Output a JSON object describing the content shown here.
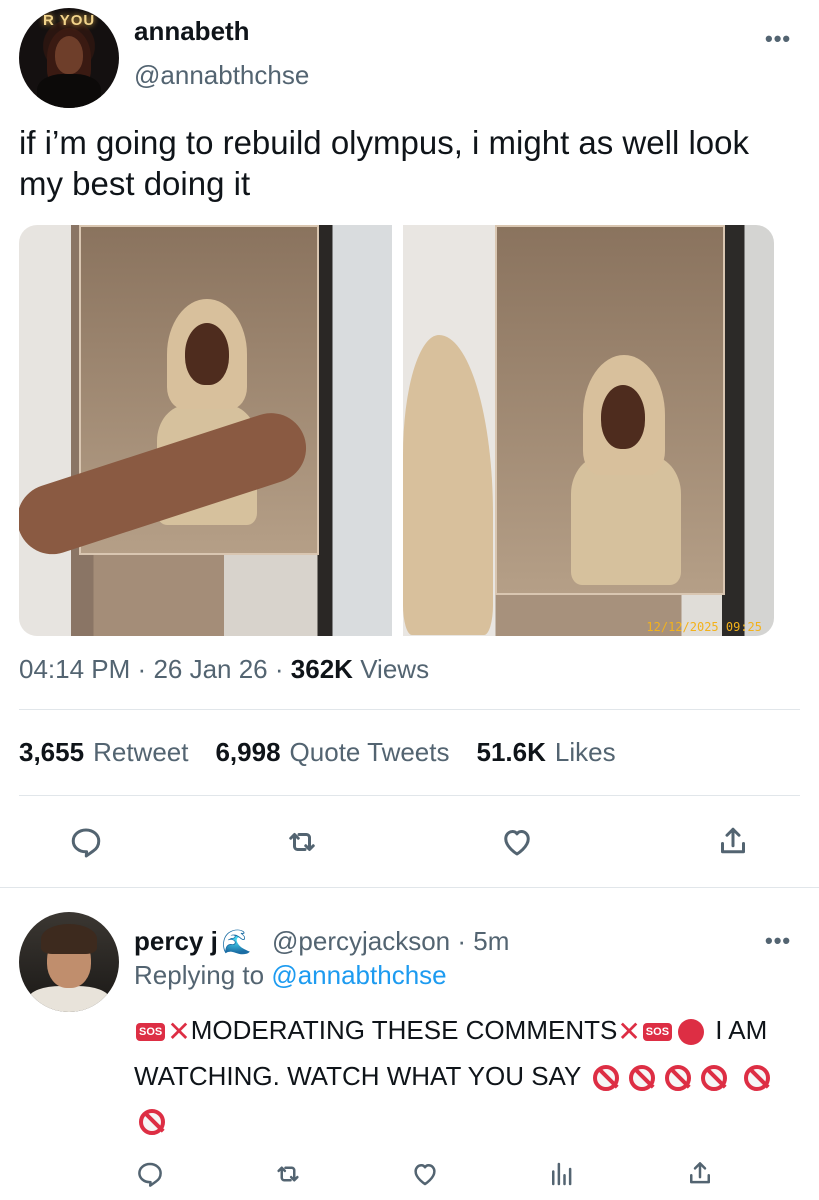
{
  "tweet": {
    "author": {
      "display_name": "annabeth",
      "handle": "@annabthchse",
      "avatar_sign_text": "R YOU"
    },
    "text": "if i’m going to rebuild olympus, i might as well look my best doing it",
    "media": {
      "photo_count": 2,
      "timestamp_stamp": "12/12/2025 09:25"
    },
    "meta": {
      "time": "04:14 PM",
      "separator": "·",
      "date": "26 Jan 26",
      "views_count": "362K",
      "views_label": "Views"
    },
    "stats": [
      {
        "count": "3,655",
        "label": "Retweet"
      },
      {
        "count": "6,998",
        "label": "Quote Tweets"
      },
      {
        "count": "51.6K",
        "label": "Likes"
      }
    ],
    "actions": [
      "reply-icon",
      "retweet-icon",
      "like-icon",
      "share-icon"
    ]
  },
  "reply": {
    "author": {
      "display_name": "percy j",
      "handle": "@percyjackson",
      "time_sep": "·",
      "time": "5m",
      "emoji_after_name": "🌊"
    },
    "replying_prefix": "Replying to",
    "replying_handle": "@annabthchse",
    "sos_label": "SOS",
    "text_part1": "MODERATING THESE COMMENTS",
    "text_part2": "I AM WATCHING. WATCH WHAT YOU SAY",
    "actions": [
      "reply-icon",
      "retweet-icon",
      "like-icon",
      "views-icon",
      "share-icon"
    ]
  },
  "colors": {
    "text": "#0f1419",
    "secondary": "#536471",
    "link": "#1d9bf0",
    "divider": "#e1e6ea",
    "emoji_red": "#dd2e44"
  }
}
